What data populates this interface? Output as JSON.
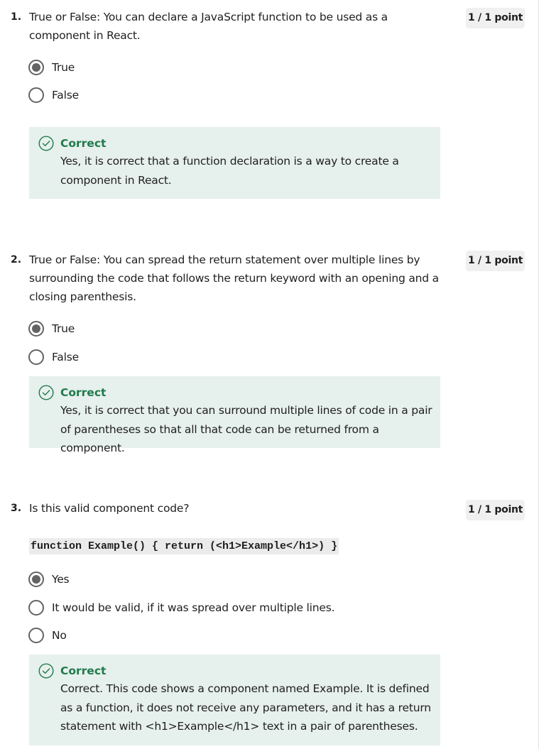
{
  "questions": [
    {
      "number": "1.",
      "text": "True or False: You can declare a JavaScript function to be used as a component in React.",
      "points": "1 / 1 point",
      "options": [
        {
          "label": "True",
          "selected": true
        },
        {
          "label": "False",
          "selected": false
        }
      ],
      "feedback": {
        "title": "Correct",
        "text": "Yes, it is correct that a function declaration is a way to create a component in React."
      }
    },
    {
      "number": "2.",
      "text": "True or False: You can spread the return statement over multiple lines by surrounding the code that follows the return keyword with an opening and a closing parenthesis.",
      "points": "1 / 1 point",
      "options": [
        {
          "label": "True",
          "selected": true
        },
        {
          "label": "False",
          "selected": false
        }
      ],
      "feedback": {
        "title": "Correct",
        "text": "Yes, it is correct that you can surround multiple lines of code in a pair of parentheses so that all that code can be returned from a component."
      }
    },
    {
      "number": "3.",
      "text": "Is this valid component code?",
      "code": "function Example() { return (<h1>Example</h1>) }",
      "points": "1 / 1 point",
      "options": [
        {
          "label": "Yes",
          "selected": true
        },
        {
          "label": "It would be valid, if it was spread over multiple lines.",
          "selected": false
        },
        {
          "label": "No",
          "selected": false
        }
      ],
      "feedback": {
        "title": "Correct",
        "text": "Correct. This code shows a component named Example. It is defined as a function, it does not receive any parameters, and it has a return statement with <h1>Example</h1> text in a pair of parentheses."
      }
    }
  ],
  "icons": {
    "correct": "check-circle-icon"
  },
  "colors": {
    "correct_text": "#1f7a4c",
    "feedback_bg": "#e6f0ec",
    "points_bg": "#f0f0f0",
    "radio": "#636363"
  }
}
